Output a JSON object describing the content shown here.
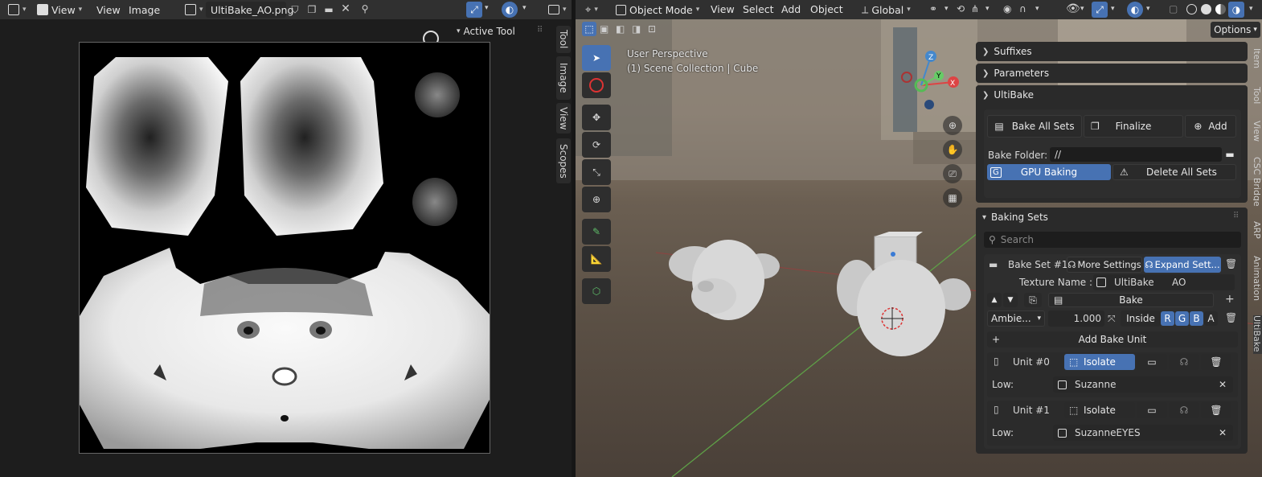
{
  "image_editor": {
    "header": {
      "view_label": "View",
      "menu_view": "View",
      "menu_image": "Image",
      "image_name": "UltiBake_AO.png"
    },
    "active_tool_label": "Active Tool",
    "side_tabs": [
      "Tool",
      "Image",
      "View",
      "Scopes"
    ]
  },
  "viewport": {
    "header": {
      "mode": "Object Mode",
      "menus": [
        "View",
        "Select",
        "Add",
        "Object"
      ],
      "transform_orientation": "Global",
      "options_label": "Options"
    },
    "overlay_text": {
      "perspective": "User Perspective",
      "collection": "(1) Scene Collection | Cube"
    },
    "gizmo": {
      "x": "X",
      "y": "Y",
      "z": "Z"
    },
    "n_tabs": [
      "Item",
      "Tool",
      "View",
      "CSC Bridge",
      "ARP",
      "Animation",
      "UltiBake"
    ]
  },
  "sidebar": {
    "suffixes": "Suffixes",
    "parameters": "Parameters",
    "ultibake": {
      "title": "UltiBake",
      "bake_all_sets": "Bake All Sets",
      "finalize": "Finalize",
      "add": "Add",
      "bake_folder_label": "Bake Folder:",
      "bake_folder_value": "//",
      "gpu_baking": "GPU Baking",
      "delete_all_sets": "Delete All Sets"
    },
    "baking_sets": {
      "title": "Baking Sets",
      "search_placeholder": "Search",
      "set_name": "Bake Set #1",
      "more_settings": "More Settings",
      "expand_settings": "Expand Sett...",
      "texture_name_label": "Texture Name :",
      "texture_prefix": "UltiBake",
      "texture_suffix": "AO",
      "bake_button": "Bake",
      "bake_type": "Ambie...",
      "value": "1.000",
      "inside": "Inside",
      "channels": [
        "R",
        "G",
        "B",
        "A"
      ],
      "add_bake_unit": "Add Bake Unit",
      "units": [
        {
          "name": "Unit #0",
          "isolate": "Isolate",
          "low_label": "Low:",
          "low_object": "Suzanne",
          "isolate_active": true
        },
        {
          "name": "Unit #1",
          "isolate": "Isolate",
          "low_label": "Low:",
          "low_object": "SuzanneEYES",
          "isolate_active": false
        }
      ]
    }
  },
  "colors": {
    "accent": "#4772b3",
    "header": "#303030",
    "panel": "#2a2a2a",
    "field": "#1d1d1d",
    "button": "#545454"
  }
}
